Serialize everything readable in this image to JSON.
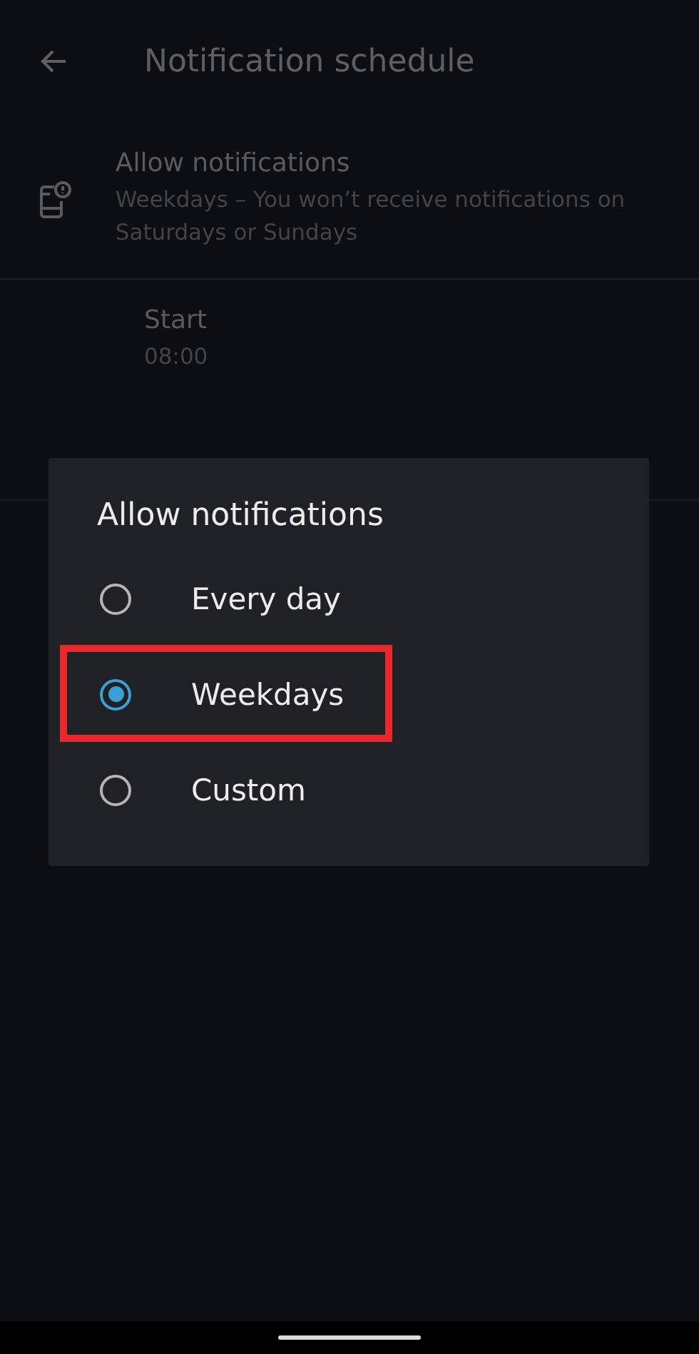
{
  "app_bar": {
    "title": "Notification schedule"
  },
  "settings": [
    {
      "kind": "icon",
      "title": "Allow notifications",
      "subtitle": "Weekdays – You won’t receive notifications on Saturdays or Sundays"
    },
    {
      "kind": "plain",
      "title": "Start",
      "subtitle": "08:00"
    }
  ],
  "dialog": {
    "title": "Allow notifications",
    "options": [
      {
        "label": "Every day",
        "selected": false,
        "highlighted": false
      },
      {
        "label": "Weekdays",
        "selected": true,
        "highlighted": true
      },
      {
        "label": "Custom",
        "selected": false,
        "highlighted": false
      }
    ]
  }
}
